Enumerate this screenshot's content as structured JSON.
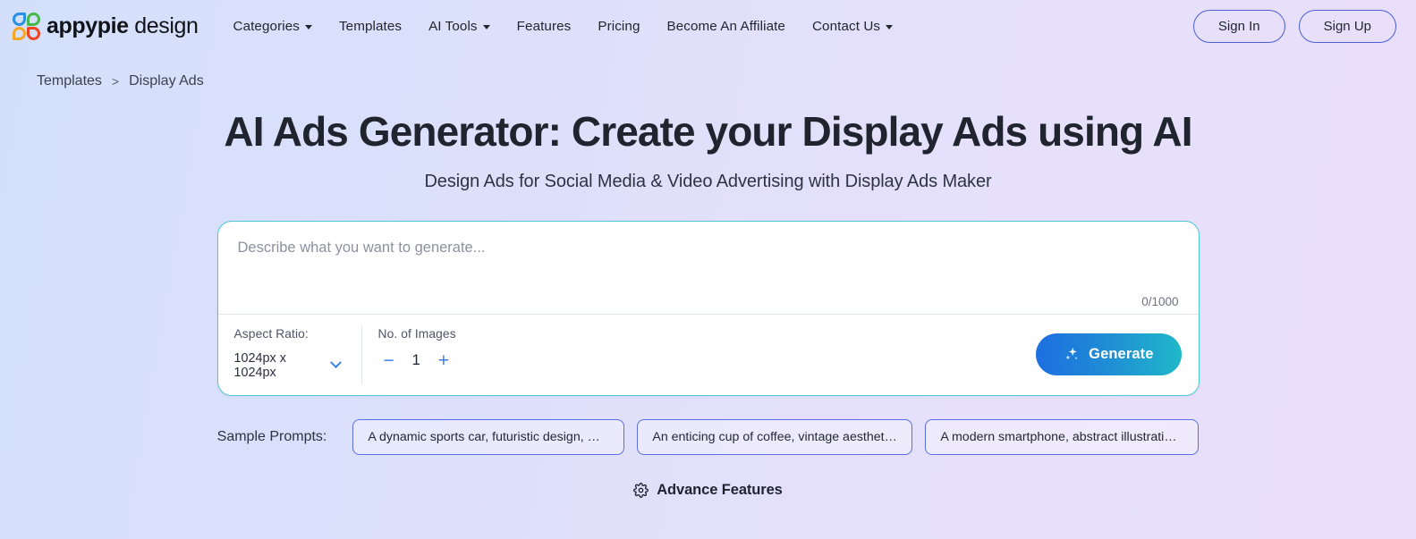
{
  "header": {
    "brand": {
      "bold": "appypie",
      "light": "design",
      "logo_icon": "appypie-flower-logo"
    },
    "nav": [
      {
        "label": "Categories",
        "has_dropdown": true
      },
      {
        "label": "Templates",
        "has_dropdown": false
      },
      {
        "label": "AI Tools",
        "has_dropdown": true
      },
      {
        "label": "Features",
        "has_dropdown": false
      },
      {
        "label": "Pricing",
        "has_dropdown": false
      },
      {
        "label": "Become An Affiliate",
        "has_dropdown": false
      },
      {
        "label": "Contact Us",
        "has_dropdown": true
      }
    ],
    "sign_in": "Sign In",
    "sign_up": "Sign Up"
  },
  "breadcrumb": {
    "parent": "Templates",
    "separator": ">",
    "current": "Display Ads"
  },
  "hero": {
    "title": "AI Ads Generator: Create your Display Ads using AI",
    "subtitle": "Design Ads for Social Media & Video Advertising with Display Ads Maker"
  },
  "generator": {
    "prompt_value": "",
    "prompt_placeholder": "Describe what you want to generate...",
    "char_count": "0/1000",
    "aspect_ratio": {
      "label": "Aspect Ratio:",
      "value": "1024px x 1024px",
      "chevron_icon": "chevron-down-icon"
    },
    "images": {
      "label": "No. of Images",
      "decrement": "−",
      "value": "1",
      "increment": "+"
    },
    "generate_button": {
      "label": "Generate",
      "icon": "sparkle-icon"
    }
  },
  "samples": {
    "label": "Sample Prompts:",
    "chips": [
      "A dynamic sports car, futuristic design, minim…",
      "An enticing cup of coffee, vintage aesthetic, d…",
      "A modern smartphone, abstract illustration, te…"
    ]
  },
  "advance": {
    "label": "Advance Features",
    "icon": "gear-icon"
  },
  "colors": {
    "bg_gradient_start": "#d4e0fb",
    "bg_gradient_end": "#eadffb",
    "card_border": "#4ec8d4",
    "accent_blue": "#3b7fe8",
    "chip_border": "#5a6ee0",
    "auth_border": "#4a5fd4",
    "generate_gradient_start": "#1e6fe0",
    "generate_gradient_end": "#1fb8c9"
  }
}
